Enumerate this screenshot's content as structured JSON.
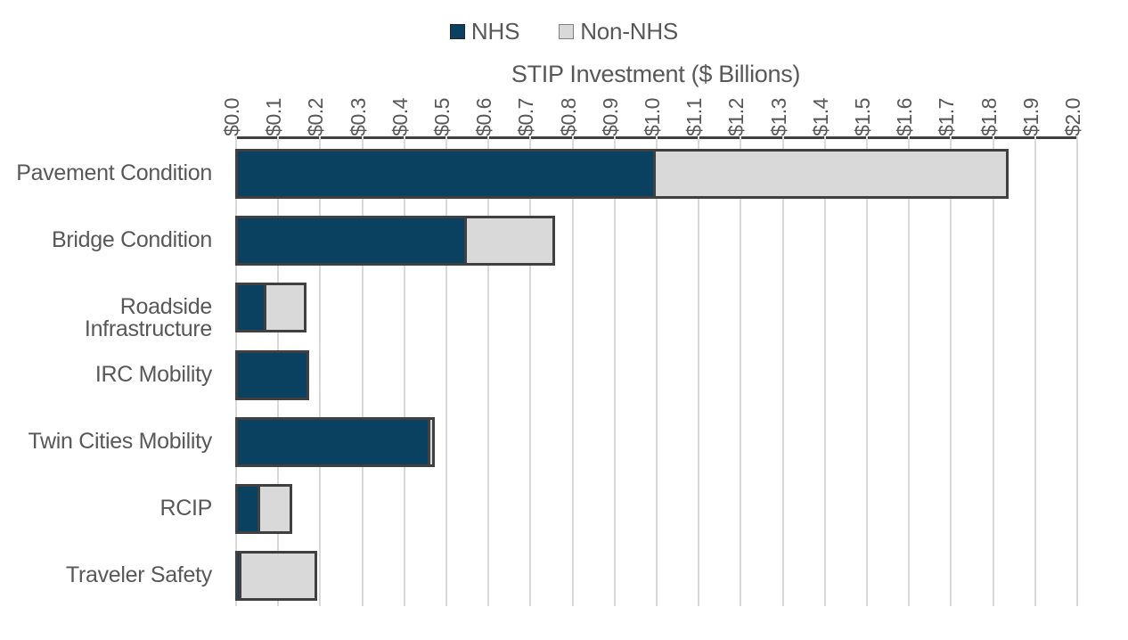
{
  "chart_data": {
    "type": "bar",
    "orientation": "horizontal",
    "stacked": true,
    "title": "STIP Investment ($ Billions)",
    "xlabel": "STIP Investment ($ Billions)",
    "ylabel": "",
    "xlim": [
      0.0,
      2.0
    ],
    "xtick_step": 0.1,
    "grid": true,
    "legend_position": "top-center",
    "axis_position": "top",
    "tick_labels": [
      "$0.0",
      "$0.1",
      "$0.2",
      "$0.3",
      "$0.4",
      "$0.5",
      "$0.6",
      "$0.7",
      "$0.8",
      "$0.9",
      "$1.0",
      "$1.1",
      "$1.2",
      "$1.3",
      "$1.4",
      "$1.5",
      "$1.6",
      "$1.7",
      "$1.8",
      "$1.9",
      "$2.0"
    ],
    "tick_values": [
      0.0,
      0.1,
      0.2,
      0.3,
      0.4,
      0.5,
      0.6,
      0.7,
      0.8,
      0.9,
      1.0,
      1.1,
      1.2,
      1.3,
      1.4,
      1.5,
      1.6,
      1.7,
      1.8,
      1.9,
      2.0
    ],
    "categories": [
      "Pavement Condition",
      "Bridge Condition",
      "Roadside Infrastructure",
      "IRC Mobility",
      "Twin Cities Mobility",
      "RCIP",
      "Traveler Safety"
    ],
    "series": [
      {
        "name": "NHS",
        "color": "#0a4160",
        "values": [
          1.0,
          0.55,
          0.075,
          0.175,
          0.465,
          0.06,
          0.015
        ]
      },
      {
        "name": "Non-NHS",
        "color": "#d9d9d9",
        "values": [
          0.84,
          0.21,
          0.095,
          0.0,
          0.01,
          0.075,
          0.18
        ]
      }
    ],
    "totals": [
      1.84,
      0.76,
      0.17,
      0.175,
      0.475,
      0.135,
      0.195
    ]
  },
  "legend": {
    "items": [
      {
        "label": "NHS",
        "swatch": "nhs"
      },
      {
        "label": "Non-NHS",
        "swatch": "nonnhs"
      }
    ]
  },
  "colors": {
    "nhs": "#0a4160",
    "non_nhs": "#d9d9d9",
    "bar_outline": "#404040",
    "gridline": "#d9d9d9",
    "text": "#585858"
  }
}
